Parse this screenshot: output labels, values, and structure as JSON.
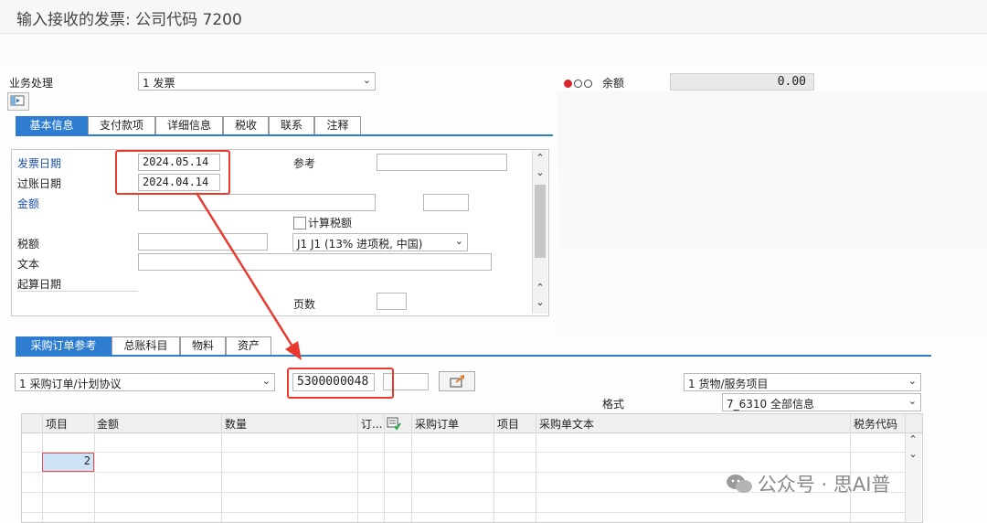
{
  "window": {
    "title": "输入接收的发票: 公司代码 7200"
  },
  "header": {
    "transaction_label": "业务处理",
    "transaction_value": "1 发票",
    "balance_label": "余额",
    "balance_value": "0.00",
    "colors": {
      "traffic_red": "#d9242a",
      "traffic_off": "#ffffff"
    }
  },
  "tabs": [
    "基本信息",
    "支付款项",
    "详细信息",
    "税收",
    "联系",
    "注释"
  ],
  "basic": {
    "invoice_date_label": "发票日期",
    "invoice_date_value": "2024.05.14",
    "posting_date_label": "过账日期",
    "posting_date_value": "2024.04.14",
    "amount_label": "金额",
    "amount_value": "",
    "currency_value": "",
    "calc_tax_label": "计算税额",
    "tax_label": "税额",
    "tax_value": "",
    "tax_code_value": "J1 J1 (13% 进项税, 中国)",
    "text_label": "文本",
    "text_value": "",
    "baseline_label": "起算日期",
    "reference_label": "参考",
    "reference_value": "",
    "pages_label": "页数",
    "pages_value": ""
  },
  "ref_tabs": [
    "采购订单参考",
    "总账科目",
    "物料",
    "资产"
  ],
  "po": {
    "type_value": "1 采购订单/计划协议",
    "number_value": "5300000048",
    "extra_value": "",
    "items_value": "1 货物/服务项目",
    "layout_label": "格式",
    "layout_value": "7_6310 全部信息"
  },
  "table": {
    "headers": [
      "项目",
      "金额",
      "数量",
      "订...",
      "采购订单",
      "项目",
      "采购单文本",
      "税务代码"
    ],
    "rows": [
      {
        "item": "",
        "amount": ""
      },
      {
        "item": "2",
        "amount": ""
      },
      {
        "item": "",
        "amount": ""
      },
      {
        "item": "",
        "amount": ""
      }
    ]
  },
  "watermark": {
    "text": "公众号 · 思AI普"
  },
  "accent": "#2e7dd1",
  "annotation_color": "#e83a2e"
}
